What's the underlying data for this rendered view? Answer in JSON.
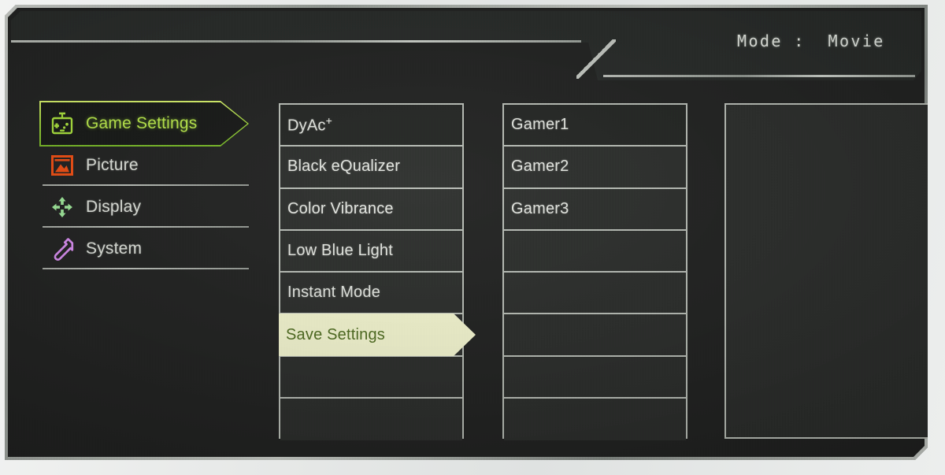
{
  "header": {
    "mode_label": "Mode :",
    "mode_value": "Movie",
    "mode_text": "Mode :  Movie"
  },
  "sidebar": {
    "items": [
      {
        "label": "Game Settings",
        "icon": "gamepad-icon",
        "color": "#a8e03c",
        "active": true
      },
      {
        "label": "Picture",
        "icon": "picture-icon",
        "color": "#ef4d12",
        "active": false
      },
      {
        "label": "Display",
        "icon": "display-arrows-icon",
        "color": "#9fe89a",
        "active": false
      },
      {
        "label": "System",
        "icon": "wrench-icon",
        "color": "#d88cf0",
        "active": false
      }
    ]
  },
  "column2": {
    "rows": [
      {
        "label": "DyAc",
        "superscript": "+",
        "highlighted": false
      },
      {
        "label": "Black eQualizer",
        "highlighted": false
      },
      {
        "label": "Color Vibrance",
        "highlighted": false
      },
      {
        "label": "Low Blue Light",
        "highlighted": false
      },
      {
        "label": "Instant Mode",
        "highlighted": false
      },
      {
        "label": "Save Settings",
        "highlighted": true
      },
      {
        "label": "",
        "highlighted": false
      },
      {
        "label": "",
        "highlighted": false
      }
    ]
  },
  "column3": {
    "rows": [
      {
        "label": "Gamer1"
      },
      {
        "label": "Gamer2"
      },
      {
        "label": "Gamer3"
      },
      {
        "label": ""
      },
      {
        "label": ""
      },
      {
        "label": ""
      },
      {
        "label": ""
      },
      {
        "label": ""
      }
    ]
  },
  "column4": {
    "rows": [
      {
        "label": ""
      }
    ]
  },
  "colors": {
    "accent_green": "#a8e03c",
    "highlight_bg": "#f2f4cf",
    "highlight_text": "#4d6b1f",
    "panel_bg": "#212221",
    "row_bg": "#2b2d2b",
    "border": "#b7bcb5",
    "text": "#e2e5df"
  }
}
